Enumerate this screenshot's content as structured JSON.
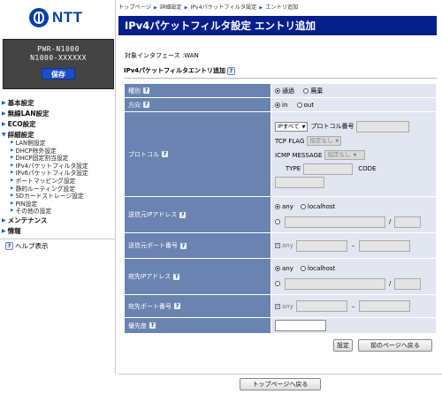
{
  "brand": {
    "logo_text": "NTT"
  },
  "model": {
    "line1": "PWR-N1000",
    "line2": "N1000-XXXXXX",
    "save_label": "保存"
  },
  "nav": {
    "basic": "基本設定",
    "wireless": "無線LAN設定",
    "eco": "ECO設定",
    "advanced": "詳細設定",
    "sub": [
      "LAN側設定",
      "DHCP除外設定",
      "DHCP固定割当設定",
      "IPv4パケットフィルタ設定",
      "IPv6パケットフィルタ設定",
      "ポートマッピング設定",
      "静的ルーティング設定",
      "SDカードストレージ設定",
      "PIN設定",
      "その他の設定"
    ],
    "maintenance": "メンテナンス",
    "info": "情報",
    "help": "ヘルプ表示"
  },
  "breadcrumb": [
    "トップページ",
    "詳細設定",
    "IPv4パケットフィルタ設定",
    "エントリ追加"
  ],
  "page_title": "IPv4パケットフィルタ設定 エントリ追加",
  "interface_text": "対象インタフェース :WAN",
  "section_title": "IPv4パケットフィルタエントリ追加",
  "form": {
    "type": {
      "label": "種別",
      "opt1": "通過",
      "opt2": "廃棄"
    },
    "direction": {
      "label": "方向",
      "opt1": "in",
      "opt2": "out"
    },
    "protocol": {
      "label": "プロトコル",
      "select_value": "IPすべて",
      "number_label": "プロトコル番号",
      "tcp_flag_label": "TCP FLAG",
      "tcp_flag_value": "指定なし",
      "icmp_label": "ICMP MESSAGE",
      "icmp_value": "指定なし",
      "type_label": "TYPE",
      "code_label": "CODE"
    },
    "src_ip": {
      "label": "送信元IPアドレス",
      "opt_any": "any",
      "opt_local": "localhost",
      "slash": "/"
    },
    "src_port": {
      "label": "送信元ポート番号",
      "any": "any",
      "dash": "–"
    },
    "dst_ip": {
      "label": "宛先IPアドレス",
      "opt_any": "any",
      "opt_local": "localhost",
      "slash": "/"
    },
    "dst_port": {
      "label": "宛先ポート番号",
      "any": "any",
      "dash": "–"
    },
    "priority": {
      "label": "優先度"
    }
  },
  "buttons": {
    "set": "設定",
    "back": "前のページへ戻る",
    "top": "トップページへ戻る"
  }
}
